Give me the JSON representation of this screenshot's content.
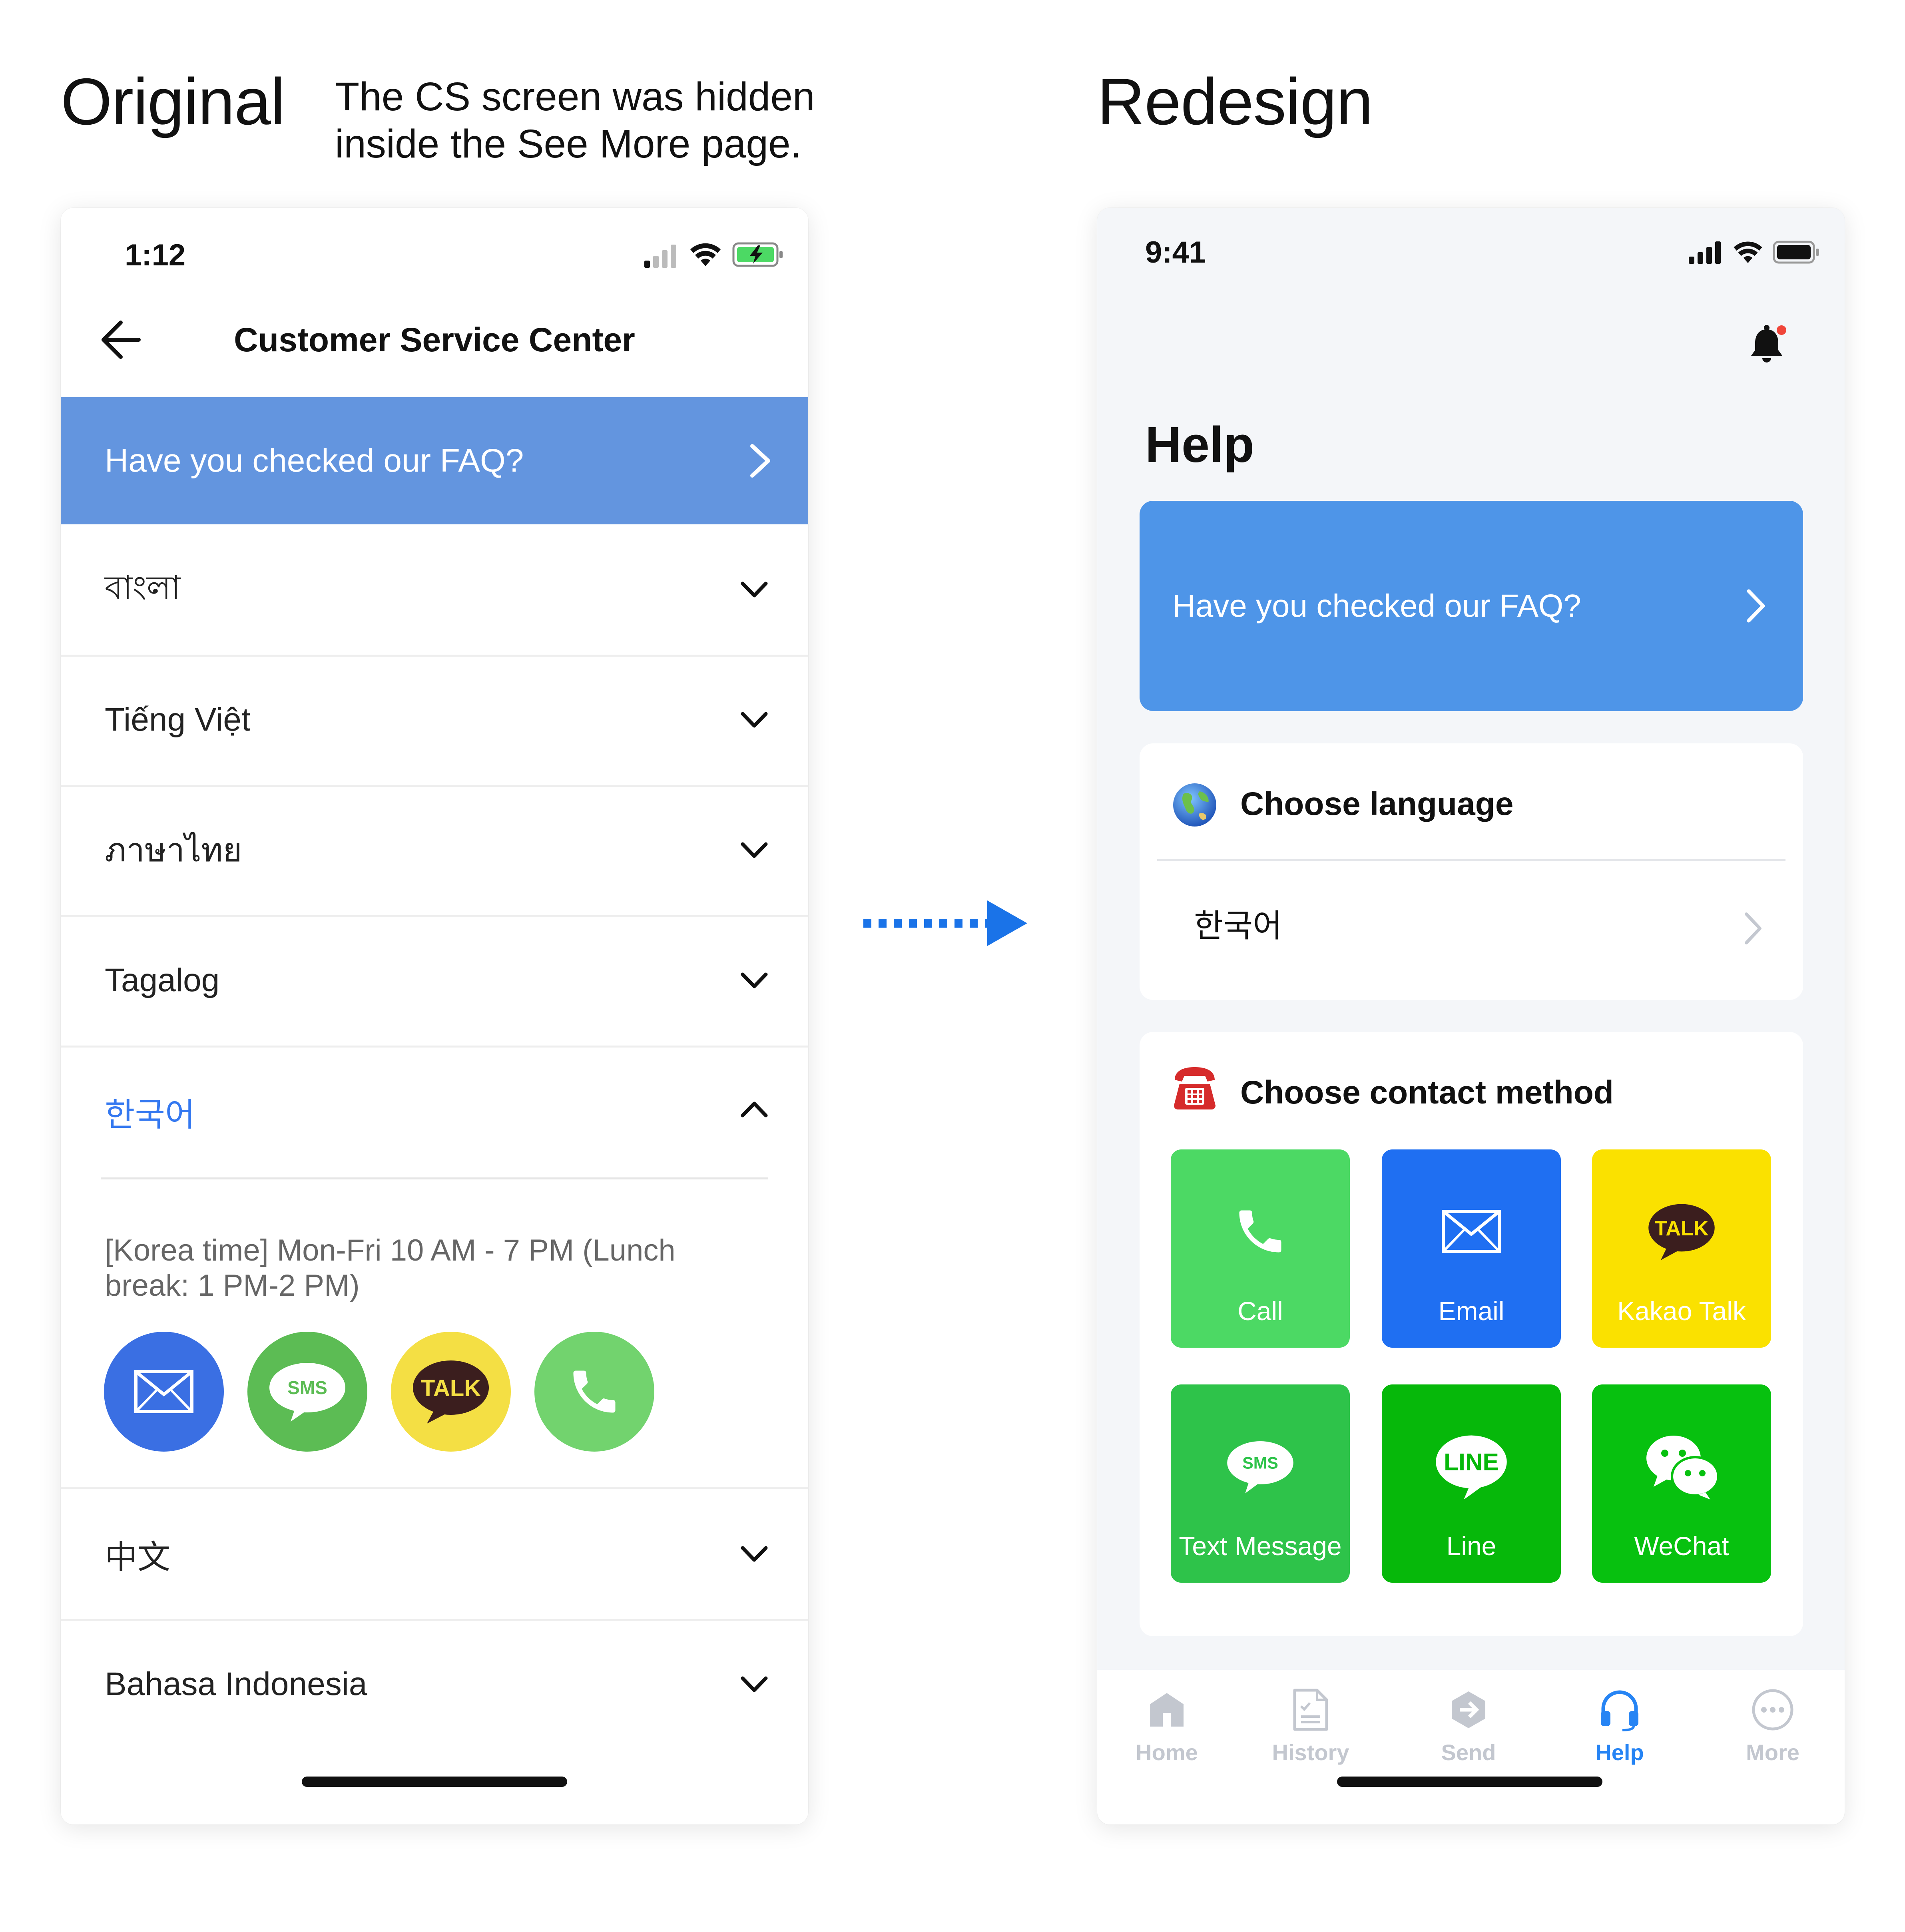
{
  "headings": {
    "original": "Original",
    "original_note": "The CS screen was hidden inside the See More page.",
    "redesign": "Redesign"
  },
  "original_screen": {
    "status_time": "1:12",
    "title": "Customer Service Center",
    "faq_banner": "Have you checked our FAQ?",
    "languages": [
      {
        "label": "বাংলা",
        "expanded": false
      },
      {
        "label": "Tiếng Việt",
        "expanded": false
      },
      {
        "label": "ภาษาไทย",
        "expanded": false
      },
      {
        "label": "Tagalog",
        "expanded": false
      },
      {
        "label": "한국어",
        "expanded": true
      },
      {
        "label": "中文",
        "expanded": false
      },
      {
        "label": "Bahasa Indonesia",
        "expanded": false
      }
    ],
    "hours": "[Korea time] Mon-Fri 10 AM - 7 PM (Lunch break: 1 PM-2 PM)",
    "contact_buttons": [
      {
        "icon": "mail-icon",
        "color": "#3a6fe3"
      },
      {
        "icon": "sms-icon",
        "label": "SMS",
        "color": "#5cbc54"
      },
      {
        "icon": "kakao-talk-icon",
        "label": "TALK",
        "color": "#f4df44"
      },
      {
        "icon": "phone-icon",
        "color": "#72d36e"
      }
    ],
    "accent_color": "#6395df",
    "expanded_color": "#3478f0"
  },
  "redesign_screen": {
    "status_time": "9:41",
    "title": "Help",
    "faq_banner": "Have you checked our FAQ?",
    "language_card": {
      "title": "Choose language",
      "icon": "globe-icon",
      "selected": "한국어"
    },
    "contact_card": {
      "title": "Choose contact method",
      "icon": "telephone-icon",
      "methods": [
        {
          "label": "Call",
          "icon": "phone-icon",
          "color": "#4cd964"
        },
        {
          "label": "Email",
          "icon": "mail-icon",
          "color": "#1f6ff2"
        },
        {
          "label": "Kakao Talk",
          "icon": "kakao-talk-icon",
          "badge": "TALK",
          "color": "#fae100"
        },
        {
          "label": "Text Message",
          "icon": "sms-icon",
          "badge": "SMS",
          "color": "#2ec34a"
        },
        {
          "label": "Line",
          "icon": "line-icon",
          "badge": "LINE",
          "color": "#06b80a"
        },
        {
          "label": "WeChat",
          "icon": "wechat-icon",
          "color": "#07c10f"
        }
      ]
    },
    "tabs": [
      {
        "label": "Home",
        "icon": "home-icon",
        "active": false
      },
      {
        "label": "History",
        "icon": "history-icon",
        "active": false
      },
      {
        "label": "Send",
        "icon": "send-icon",
        "active": false
      },
      {
        "label": "Help",
        "icon": "headset-icon",
        "active": true
      },
      {
        "label": "More",
        "icon": "more-icon",
        "active": false
      }
    ],
    "accent_color": "#2684f4"
  }
}
